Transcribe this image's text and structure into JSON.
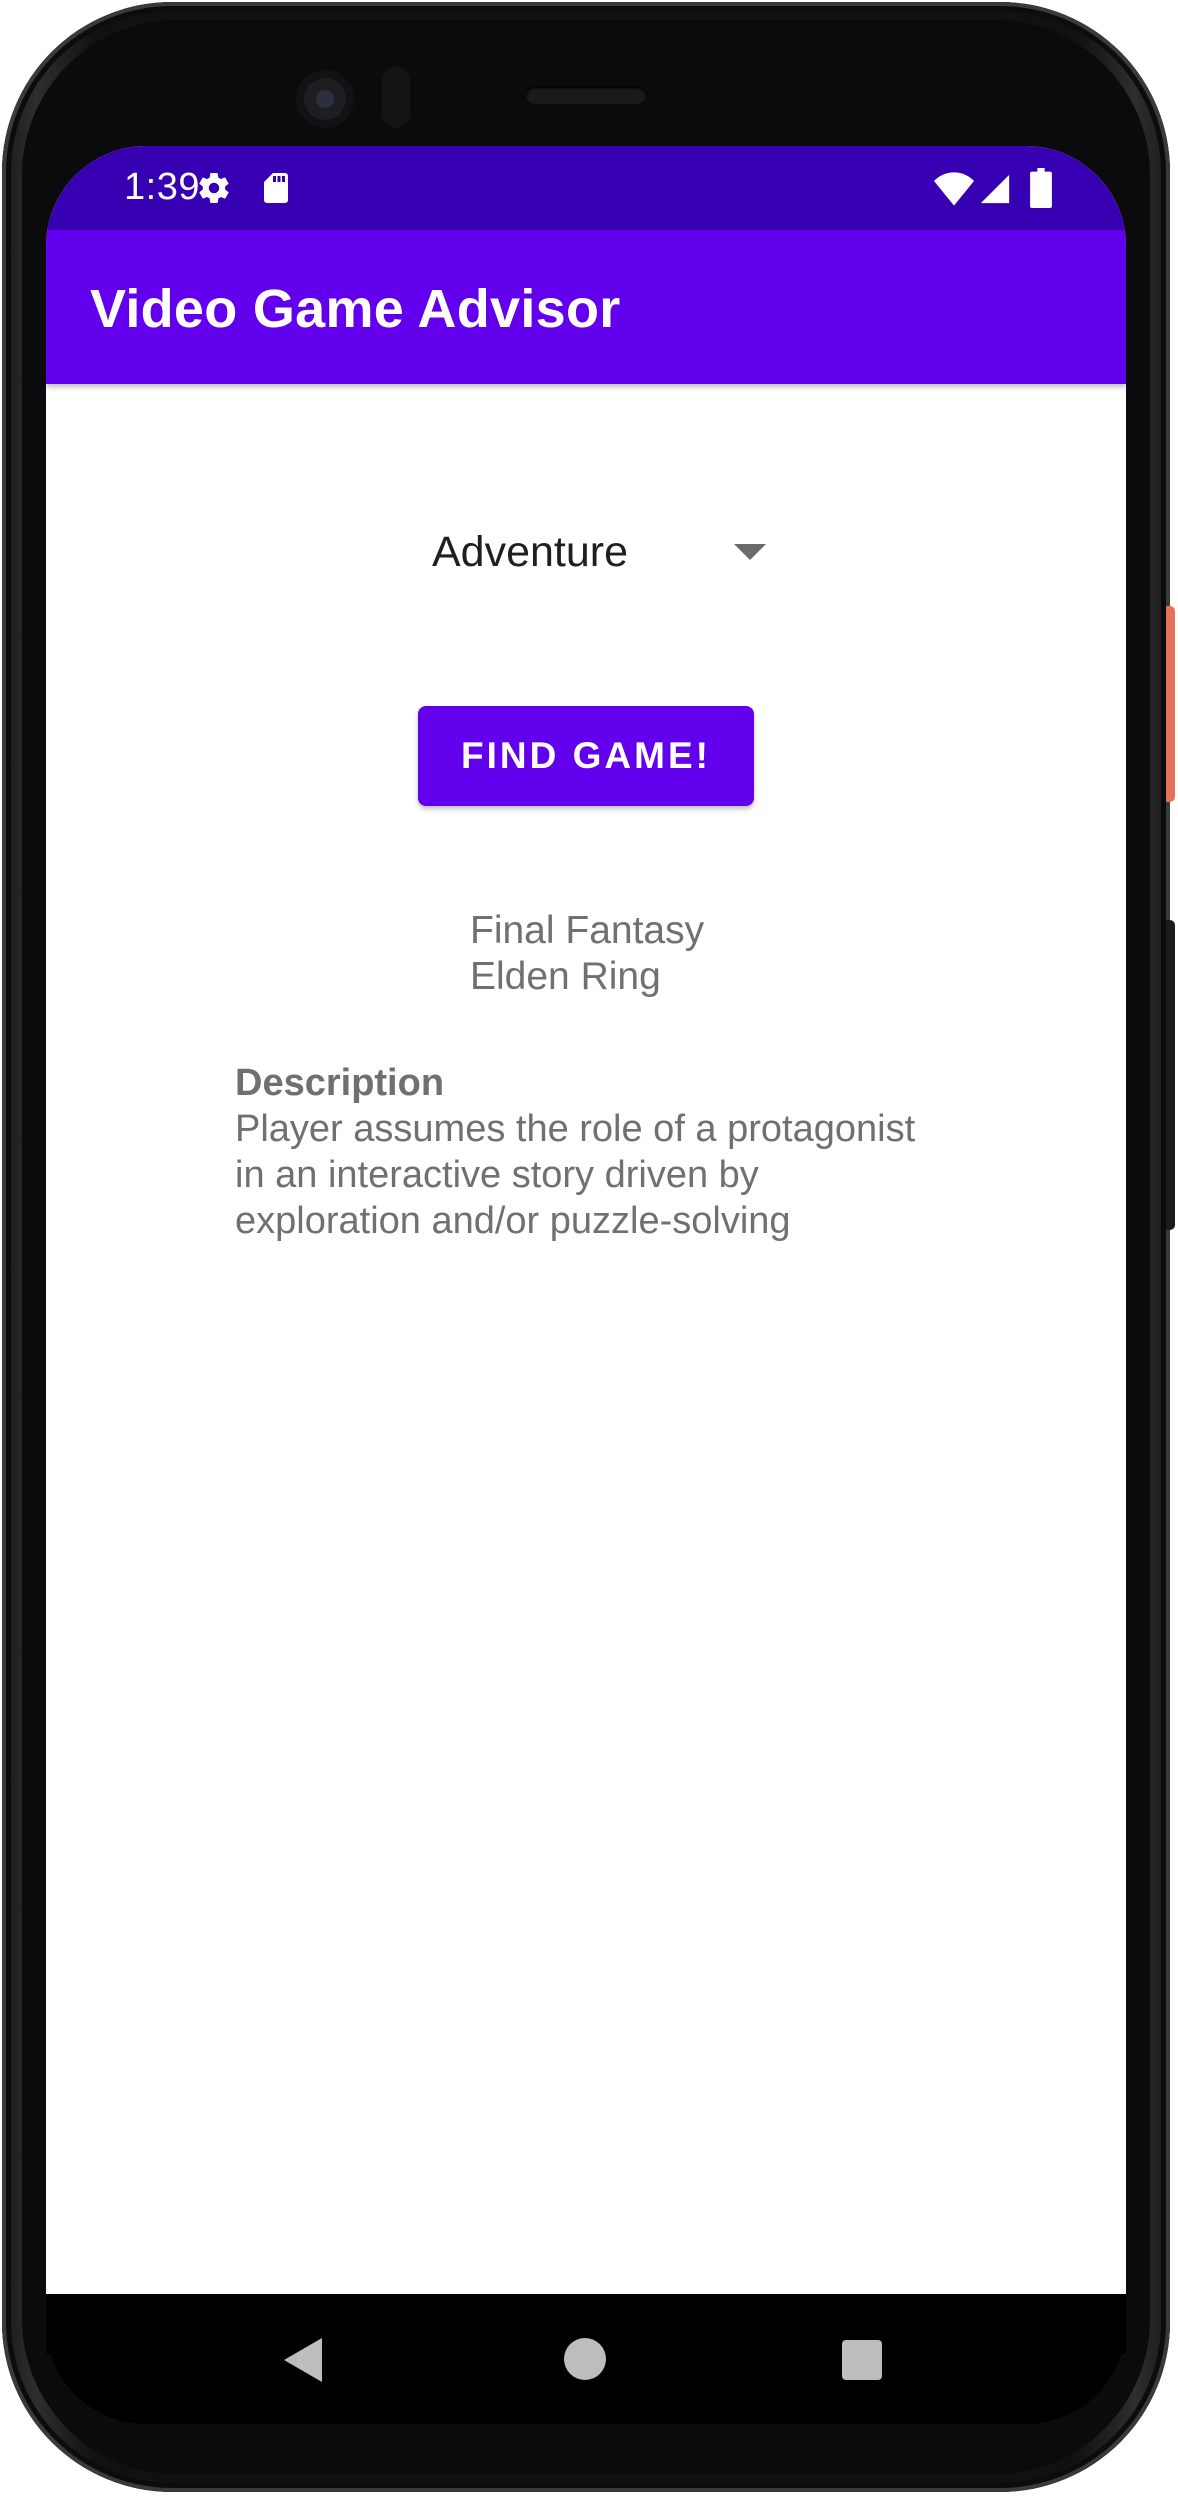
{
  "status_bar": {
    "time": "1:39",
    "icons": [
      "settings-gear-icon",
      "sd-card-icon",
      "wifi-icon",
      "cell-signal-icon",
      "battery-icon"
    ]
  },
  "app_bar": {
    "title": "Video Game Advisor",
    "color": "#6200ee",
    "status_color": "#3700b3"
  },
  "spinner": {
    "selected": "Adventure"
  },
  "find_button": {
    "label": "FIND GAME!"
  },
  "results": {
    "games": [
      "Final Fantasy",
      "Elden Ring"
    ]
  },
  "description": {
    "heading": "Description",
    "lines": [
      "Player assumes the role of a protagonist",
      "in an interactive story driven by",
      "exploration and/or puzzle-solving"
    ]
  },
  "navigation": {
    "icons": [
      "back-icon",
      "home-icon",
      "recents-icon"
    ]
  }
}
